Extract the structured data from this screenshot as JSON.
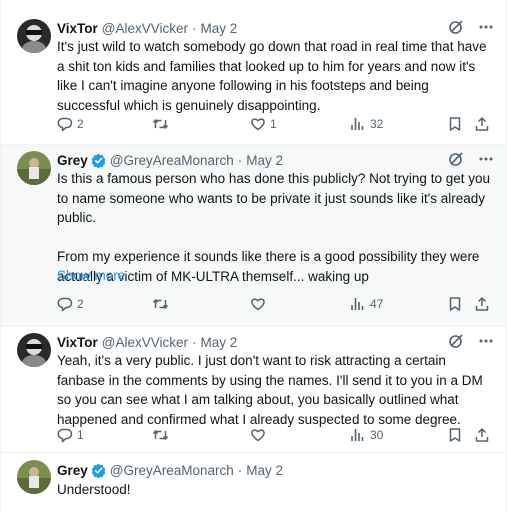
{
  "colors": {
    "text": "#0f1419",
    "muted": "#536471",
    "link": "#1d9bf0",
    "verified": "#1d9bf0",
    "border": "#eff3f4",
    "highlight_bg": "#f7f9f9"
  },
  "tweets": [
    {
      "name": "VixTor",
      "handle": "@AlexVVicker",
      "dot": "·",
      "date": "May 2",
      "verified": false,
      "paragraphs": [
        "It's just wild to watch somebody go down that road in real time that have a shit ton kids and families that looked up to him for years and now it's like I can't imagine anyone following in his footsteps and being successful which is genuinely disappointing."
      ],
      "replies": "2",
      "reposts": "",
      "likes": "1",
      "views": "32"
    },
    {
      "name": "Grey",
      "handle": "@GreyAreaMonarch",
      "dot": "·",
      "date": "May 2",
      "verified": true,
      "paragraphs": [
        "Is this a famous person who has done this publicly? Not trying to get you to name someone who wants to be private it just sounds like it's already public.",
        "From my experience it sounds like there is a good possibility they were actually a victim of MK-ULTRA themself... waking up"
      ],
      "show_more": "Show more",
      "replies": "2",
      "reposts": "",
      "likes": "",
      "views": "47"
    },
    {
      "name": "VixTor",
      "handle": "@AlexVVicker",
      "dot": "·",
      "date": "May 2",
      "verified": false,
      "paragraphs": [
        "Yeah, it's a very public. I just don't want to risk attracting a certain fanbase in the comments by using the names. I'll send it to you in a DM so you can see what I am talking about, you basically outlined what happened and confirmed what I already suspected to some degree."
      ],
      "replies": "1",
      "reposts": "",
      "likes": "",
      "views": "30"
    },
    {
      "name": "Grey",
      "handle": "@GreyAreaMonarch",
      "dot": "·",
      "date": "May 2",
      "verified": true,
      "paragraphs": [
        "Understood!"
      ]
    }
  ],
  "icons": {
    "grok": "grok-icon",
    "more": "more-icon",
    "reply": "reply-icon",
    "repost": "repost-icon",
    "like": "heart-icon",
    "views": "views-icon",
    "bookmark": "bookmark-icon",
    "share": "share-icon",
    "verified": "verified-badge-icon"
  }
}
